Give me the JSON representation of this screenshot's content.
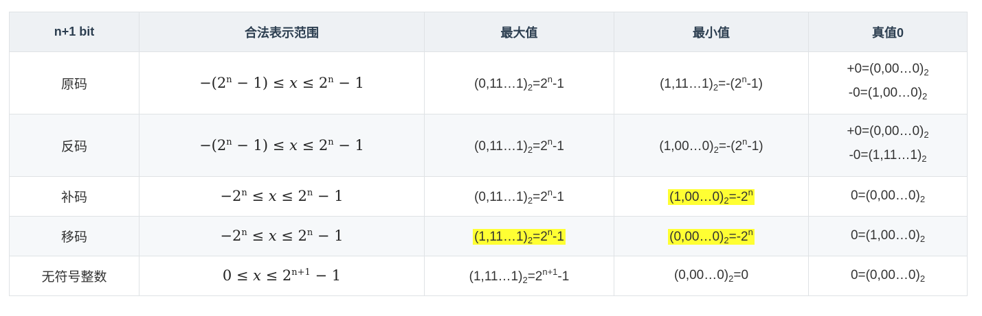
{
  "headers": [
    "n+1 bit",
    "合法表示范围",
    "最大值",
    "最小值",
    "真值0"
  ],
  "rows": [
    {
      "name": "原码",
      "range": {
        "a": "−(2",
        "n1": "n",
        "b": " − 1) ≤ ",
        "x": "x",
        "c": " ≤ 2",
        "n2": "n",
        "d": " − 1"
      },
      "max": {
        "base": "(0,11…1)",
        "sub": "2",
        "mid": "=2",
        "sup": "n",
        "tail": "-1"
      },
      "min": {
        "base": "(1,11…1)",
        "sub": "2",
        "mid": "=-(2",
        "sup": "n",
        "tail": "-1)"
      },
      "zero": [
        {
          "base": "+0=(0,00…0)",
          "sub": "2"
        },
        {
          "base": "-0=(1,00…0)",
          "sub": "2"
        }
      ]
    },
    {
      "name": "反码",
      "range": {
        "a": "−(2",
        "n1": "n",
        "b": " − 1) ≤ ",
        "x": "x",
        "c": " ≤ 2",
        "n2": "n",
        "d": " − 1"
      },
      "max": {
        "base": "(0,11…1)",
        "sub": "2",
        "mid": "=2",
        "sup": "n",
        "tail": "-1"
      },
      "min": {
        "base": "(1,00…0)",
        "sub": "2",
        "mid": "=-(2",
        "sup": "n",
        "tail": "-1)"
      },
      "zero": [
        {
          "base": "+0=(0,00…0)",
          "sub": "2"
        },
        {
          "base": "-0=(1,11…1)",
          "sub": "2"
        }
      ]
    },
    {
      "name": "补码",
      "range": {
        "a": "−2",
        "n1": "n",
        "b": " ≤ ",
        "x": "x",
        "c": " ≤ 2",
        "n2": "n",
        "d": " − 1"
      },
      "max": {
        "base": "(0,11…1)",
        "sub": "2",
        "mid": "=2",
        "sup": "n",
        "tail": "-1"
      },
      "min": {
        "base": "(1,00…0)",
        "sub": "2",
        "mid": "=-2",
        "sup": "n",
        "tail": ""
      },
      "zero": [
        {
          "base": "0=(0,00…0)",
          "sub": "2"
        }
      ]
    },
    {
      "name": "移码",
      "range": {
        "a": "−2",
        "n1": "n",
        "b": " ≤ ",
        "x": "x",
        "c": " ≤ 2",
        "n2": "n",
        "d": " − 1"
      },
      "max": {
        "base": "(1,11…1)",
        "sub": "2",
        "mid": "=2",
        "sup": "n",
        "tail": "-1"
      },
      "min": {
        "base": "(0,00…0)",
        "sub": "2",
        "mid": "=-2",
        "sup": "n",
        "tail": ""
      },
      "zero": [
        {
          "base": "0=(1,00…0)",
          "sub": "2"
        }
      ]
    },
    {
      "name": "无符号整数",
      "range": {
        "a": "0 ≤ ",
        "x": "x",
        "c": " ≤ 2",
        "n2": "n+1",
        "d": " − 1"
      },
      "max": {
        "base": "(1,11…1)",
        "sub": "2",
        "mid": "=2",
        "sup": "n+1",
        "tail": "-1"
      },
      "min": {
        "base": "(0,00…0)",
        "sub": "2",
        "mid": "=0"
      },
      "zero": [
        {
          "base": "0=(0,00…0)",
          "sub": "2"
        }
      ]
    }
  ],
  "highlight_color": "#ffff33"
}
